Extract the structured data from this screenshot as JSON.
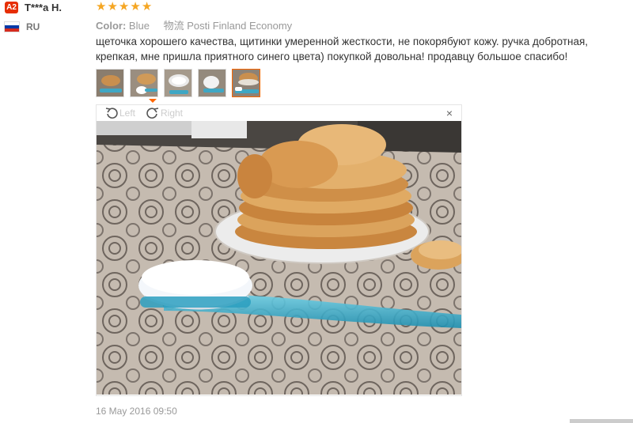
{
  "reviewer": {
    "badge": "A2",
    "name": "T***a H.",
    "country": "RU",
    "flag_colors": [
      "#ffffff",
      "#0039a6",
      "#d52b1e"
    ]
  },
  "review": {
    "rating": 5,
    "stars": [
      "★",
      "★",
      "★",
      "★",
      "★"
    ],
    "color_label": "Color:",
    "color_value": "Blue",
    "shipping_label": "物流",
    "shipping_value": "Posti Finland Economy",
    "text": "щеточка хорошего качества, щитинки умеренной жесткости, не покорябуют кожу. ручка добротная, крепкая, мне пришла приятного синего цвета) покупкой довольна! продавцу большое спасибо!",
    "date": "16 May 2016 09:50"
  },
  "viewer": {
    "rotate_left": "Left",
    "rotate_right": "Right",
    "close": "×",
    "thumbnail_count": 5,
    "active_thumbnail": 5
  },
  "colors": {
    "accent": "#f60",
    "star": "#f5a623",
    "badge": "#e62e04"
  }
}
